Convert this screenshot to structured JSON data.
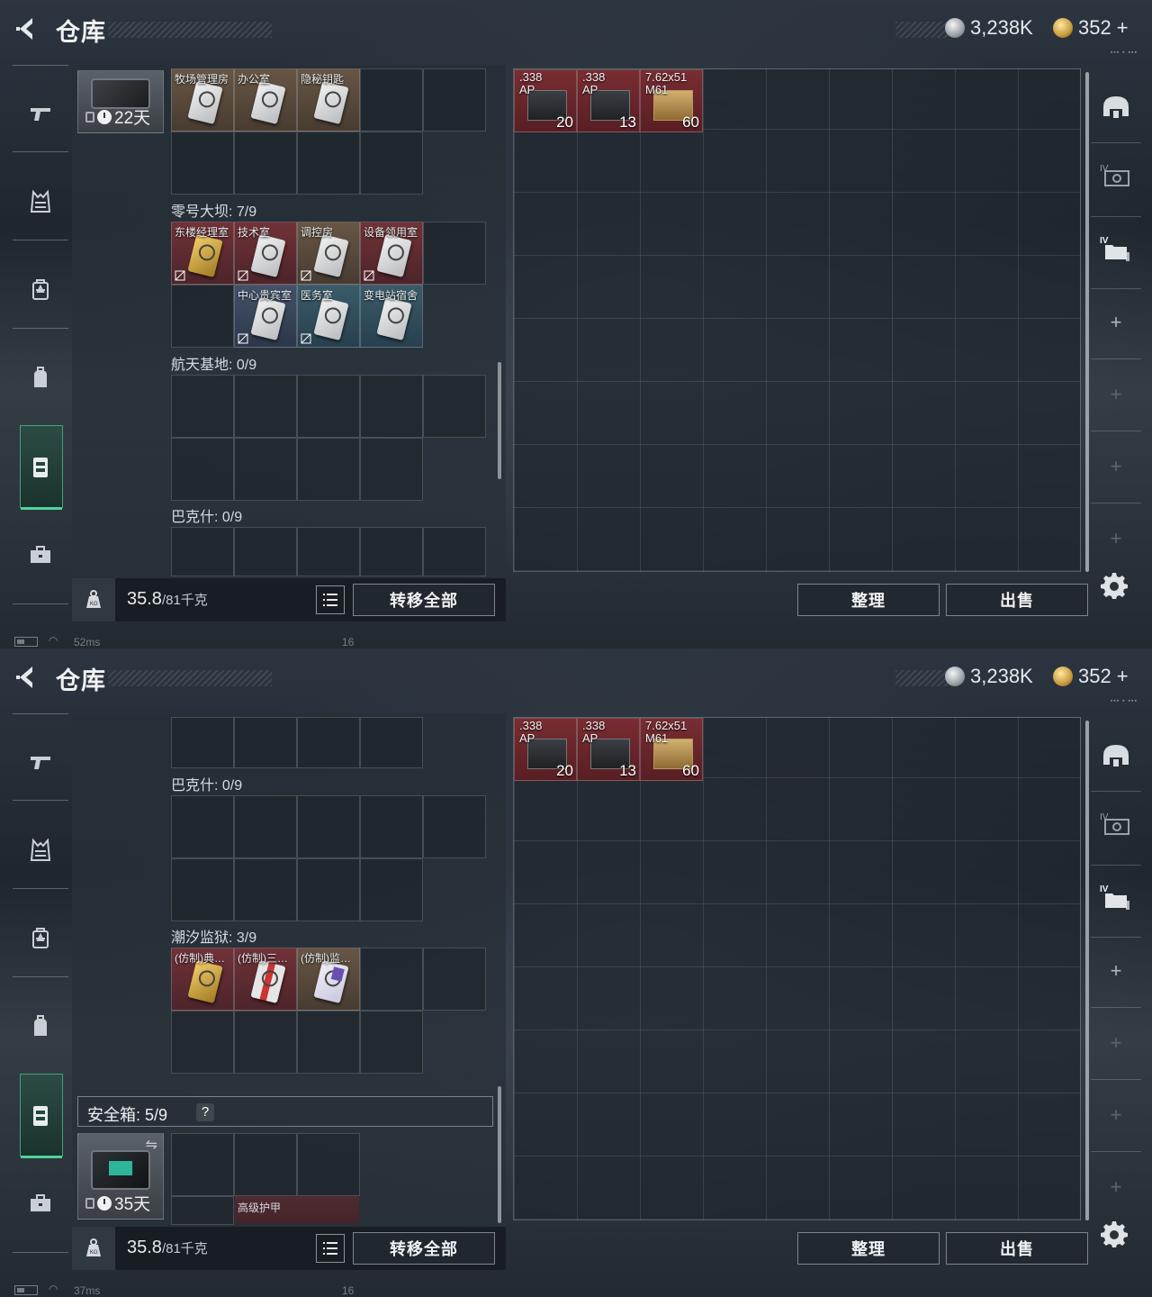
{
  "header": {
    "title": "仓库",
    "silver_amount": "3,238K",
    "gold_amount": "352",
    "gold_plus": "+"
  },
  "top": {
    "case_timer": "22天",
    "item_names_row0": [
      "牧场管理房",
      "办公室",
      "隐秘钥匙"
    ],
    "section_dam": "零号大坝: 7/9",
    "dam_row1": [
      "东楼经理室",
      "技术室",
      "调控房",
      "设备领用室"
    ],
    "dam_row2": [
      "中心贵宾室",
      "医务室",
      "变电站宿舍"
    ],
    "section_aero": "航天基地: 0/9",
    "section_bakesh": "巴克什: 0/9",
    "status_ping": "52ms",
    "status_num": "16"
  },
  "bottom": {
    "section_bakesh": "巴克什: 0/9",
    "section_prison": "潮汐监狱: 3/9",
    "prison_items": [
      "(仿制)典…",
      "(仿制)三…",
      "(仿制)监…"
    ],
    "safe_label": "安全箱:  5/9",
    "safe_help": "?",
    "case_timer": "35天",
    "armor_label": "高级护甲",
    "status_ping": "37ms",
    "status_num": "16"
  },
  "weight": {
    "current": "35.8",
    "max": "/81千克"
  },
  "buttons": {
    "transfer_all": "转移全部",
    "sort": "整理",
    "sell": "出售"
  },
  "stash_items": [
    {
      "name": ".338\nAP",
      "qty": "20"
    },
    {
      "name": ".338\nAP",
      "qty": "13"
    },
    {
      "name": "7.62x51\nM61",
      "qty": "60"
    }
  ],
  "colors": {
    "accent_active": "#3fa37a",
    "item_red": "#7d2d32"
  },
  "icons": {
    "back": "chevron-left-icon",
    "sidebar": [
      "pistol-icon",
      "vest-icon",
      "chest-rig-icon",
      "backpack-icon",
      "case-icon",
      "briefcase-icon"
    ],
    "right": [
      "helmet-icon",
      "chip-icon",
      "folder-chip-icon",
      "plus-icon"
    ]
  }
}
